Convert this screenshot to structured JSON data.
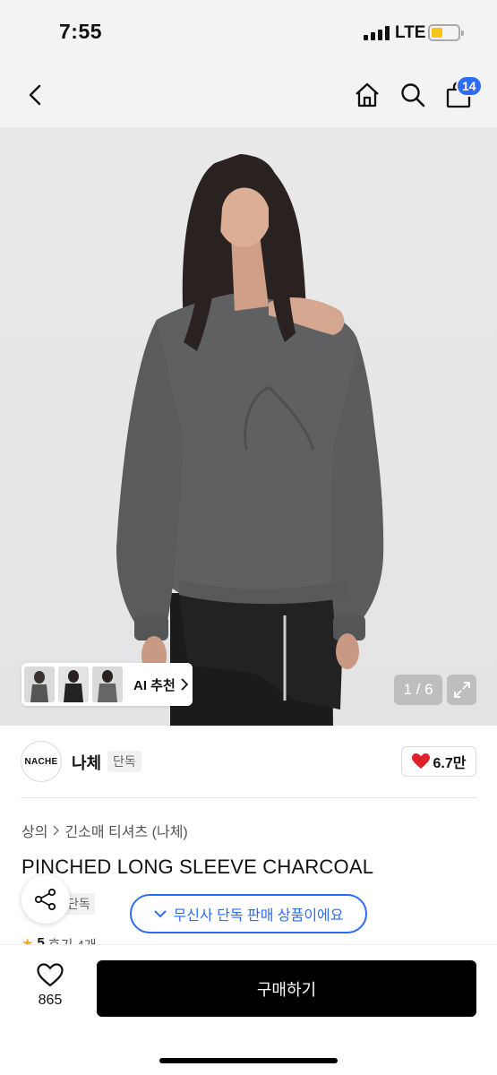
{
  "status_bar": {
    "time": "7:55",
    "network": "LTE"
  },
  "nav": {
    "cart_count": "14"
  },
  "gallery": {
    "ai_label": "AI 추천",
    "counter": "1 / 6"
  },
  "brand": {
    "logo_text": "NACHE",
    "name": "나체",
    "tag": "단독",
    "likes": "6.7만"
  },
  "product": {
    "breadcrumb": [
      "상의",
      "긴소매 티셔츠 (나체)"
    ],
    "title": "PINCHED LONG SLEEVE CHARCOAL",
    "exclusive_tag": "단독",
    "exclusive_notice": "무신사 단독 판매 상품이에요",
    "rating": "5",
    "reviews": "후기 4개"
  },
  "bottom_bar": {
    "wish_count": "865",
    "buy_label": "구매하기"
  },
  "colors": {
    "accent": "#2f6cf6",
    "heart": "#e0202a",
    "star": "#f5a623"
  }
}
